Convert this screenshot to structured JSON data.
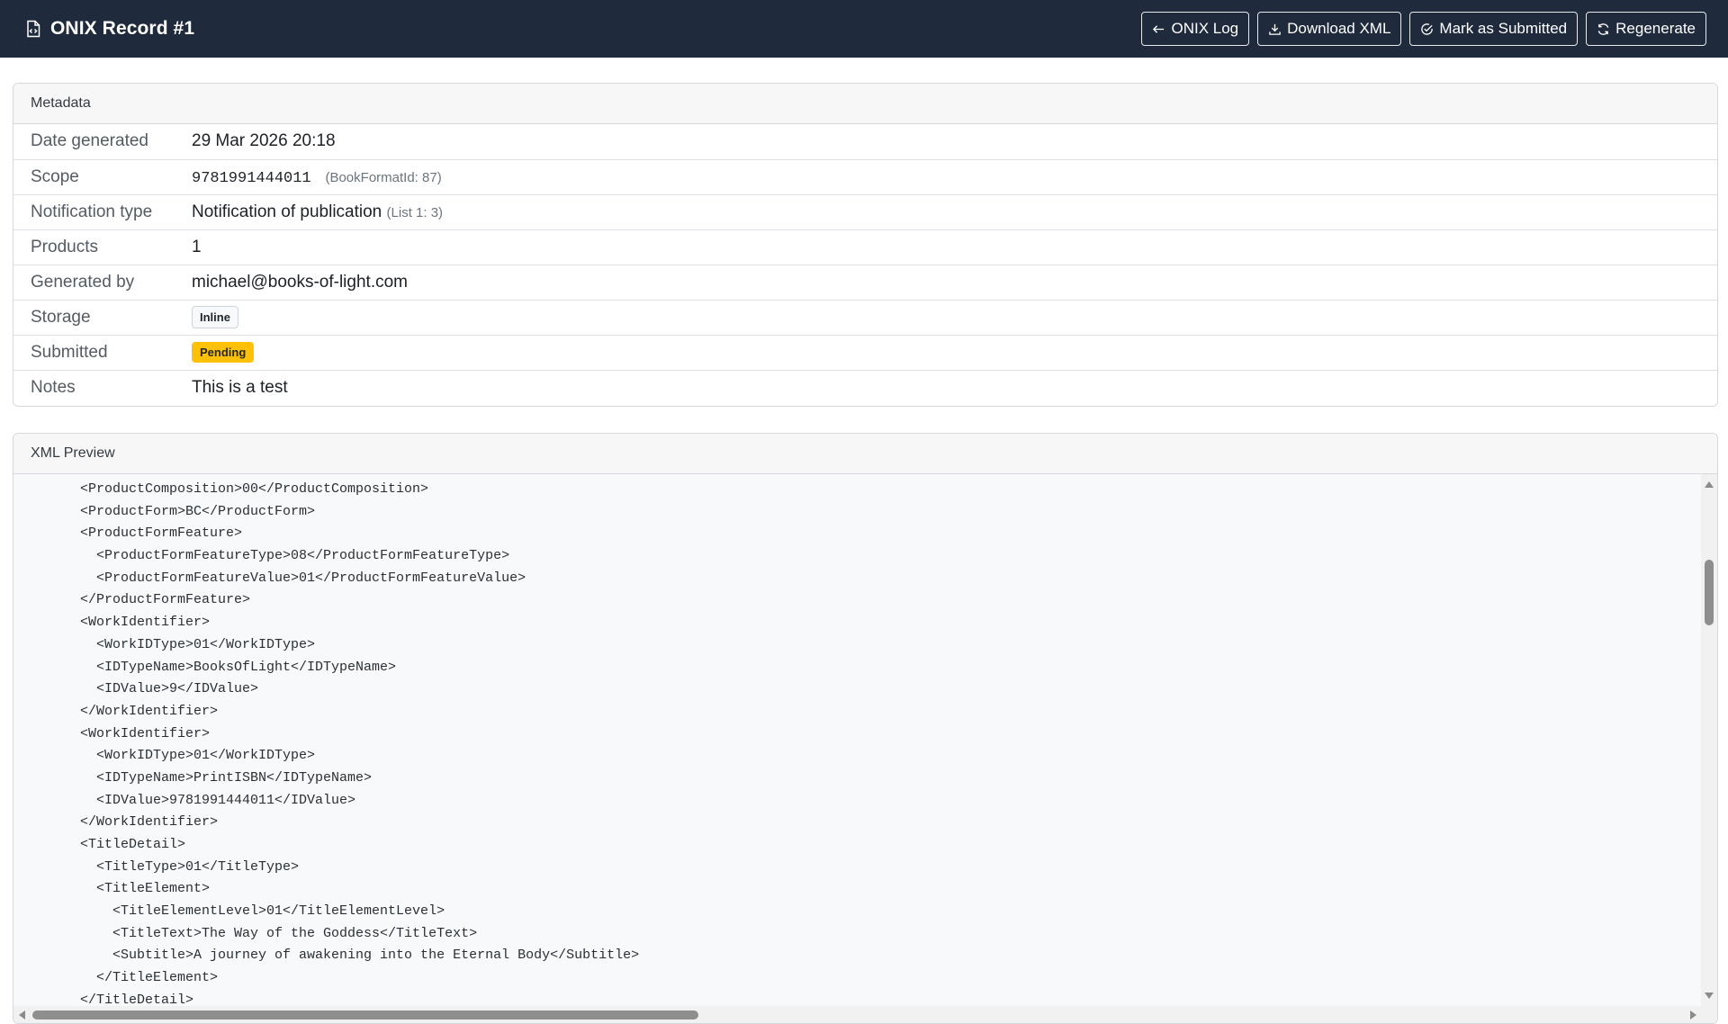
{
  "header": {
    "title": "ONIX Record #1",
    "buttons": {
      "log": "ONIX Log",
      "download": "Download XML",
      "submit": "Mark as Submitted",
      "regenerate": "Regenerate"
    }
  },
  "metadata": {
    "heading": "Metadata",
    "date_label": "Date generated",
    "date_value": "29 Mar 2026 20:18",
    "scope_label": "Scope",
    "scope_isbn": "9781991444011",
    "scope_note": "(BookFormatId: 87)",
    "notification_label": "Notification type",
    "notification_value": "Notification of publication",
    "notification_note": "(List 1: 3)",
    "products_label": "Products",
    "products_value": "1",
    "generated_by_label": "Generated by",
    "generated_by_value": "michael@books-of-light.com",
    "storage_label": "Storage",
    "storage_badge": "Inline",
    "submitted_label": "Submitted",
    "submitted_badge": "Pending",
    "notes_label": "Notes",
    "notes_value": "This is a test"
  },
  "xml_preview": {
    "heading": "XML Preview",
    "lines": [
      "<ProductComposition>00</ProductComposition>",
      "<ProductForm>BC</ProductForm>",
      "<ProductFormFeature>",
      "  <ProductFormFeatureType>08</ProductFormFeatureType>",
      "  <ProductFormFeatureValue>01</ProductFormFeatureValue>",
      "</ProductFormFeature>",
      "<WorkIdentifier>",
      "  <WorkIDType>01</WorkIDType>",
      "  <IDTypeName>BooksOfLight</IDTypeName>",
      "  <IDValue>9</IDValue>",
      "</WorkIdentifier>",
      "<WorkIdentifier>",
      "  <WorkIDType>01</WorkIDType>",
      "  <IDTypeName>PrintISBN</IDTypeName>",
      "  <IDValue>9781991444011</IDValue>",
      "</WorkIdentifier>",
      "<TitleDetail>",
      "  <TitleType>01</TitleType>",
      "  <TitleElement>",
      "    <TitleElementLevel>01</TitleElementLevel>",
      "    <TitleText>The Way of the Goddess</TitleText>",
      "    <Subtitle>A journey of awakening into the Eternal Body</Subtitle>",
      "  </TitleElement>",
      "</TitleDetail>"
    ]
  },
  "colors": {
    "topbar": "#1f2a3c",
    "pending": "#ffc107"
  },
  "icons": [
    "file-code-icon",
    "arrow-left-icon",
    "download-icon",
    "check-circle-icon",
    "refresh-icon"
  ]
}
